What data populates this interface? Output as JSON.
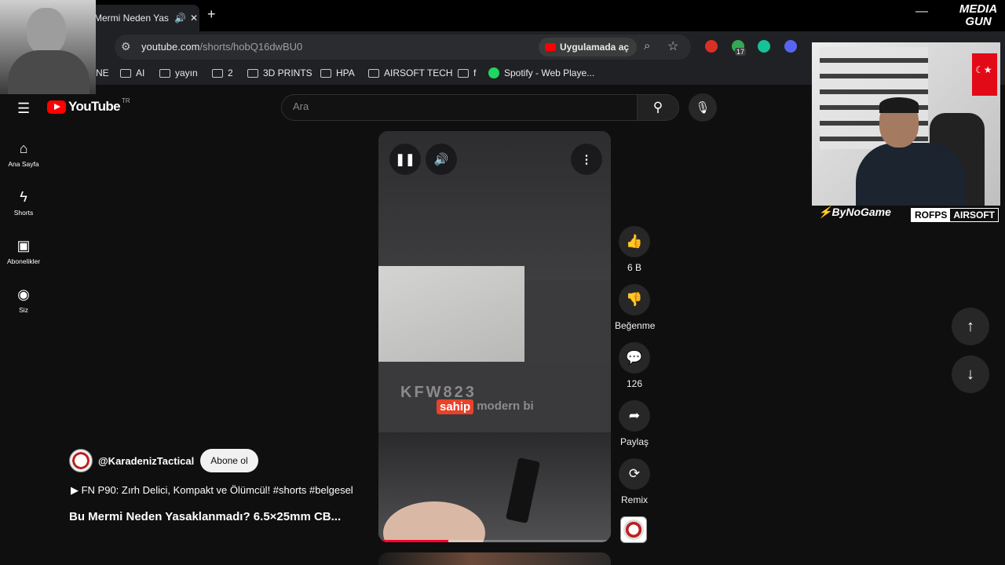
{
  "browser": {
    "tab_title": "Mermi Neden Yas",
    "omnibox": {
      "url_host": "youtube.com",
      "url_path": "/shorts/hobQ16dwBU0",
      "app_button": "Uygulamada aç"
    },
    "extension_badge": "17",
    "bookmarks": [
      "NE",
      "AI",
      "yayın",
      "2",
      "3D PRINTS",
      "HPA",
      "AIRSOFT TECH",
      "f",
      "Spotify - Web Playe..."
    ]
  },
  "overlays": {
    "brand_left": "ByNoGame",
    "rofps_a": "ROFPS",
    "rofps_b": "AIRSOFT",
    "mediagun_1": "MEDIA",
    "mediagun_2": "GUN"
  },
  "youtube": {
    "logo": "YouTube",
    "region": "TR",
    "search_placeholder": "Ara",
    "sidebar": [
      {
        "label": "Ana Sayfa"
      },
      {
        "label": "Shorts"
      },
      {
        "label": "Abonelikler"
      },
      {
        "label": "Siz"
      }
    ],
    "actions": {
      "like_count": "6 B",
      "dislike": "Beğenme",
      "comments": "126",
      "share": "Paylaş",
      "remix": "Remix"
    },
    "video_caption_highlight": "sahip",
    "video_caption_rest": "modern bi",
    "video_serial": "KFW823",
    "progress": 0.3,
    "channel_handle": "@KaradenizTactical",
    "subscribe": "Abone ol",
    "playlist": "FN P90: Zırh Delici, Kompakt ve Ölümcül! #shorts #belgesel",
    "title": "Bu Mermi Neden Yasaklanmadı? 6.5×25mm CB..."
  },
  "colors": {
    "background": "#0f0f0f",
    "accent": "#ff0000",
    "progress": "#ff0033",
    "spotify": "#1ed760"
  }
}
